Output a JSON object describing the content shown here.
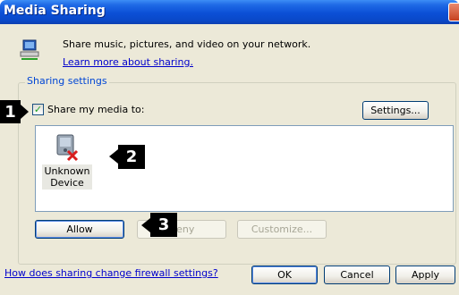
{
  "window": {
    "title": "Media Sharing"
  },
  "intro": {
    "text": "Share music, pictures, and video on your network.",
    "link": "Learn more about sharing."
  },
  "sharing_settings": {
    "group_label": "Sharing settings",
    "checkbox_label": "Share my media to:",
    "checkbox_checked": true,
    "settings_button": "Settings..."
  },
  "devices": [
    {
      "label": "Unknown Device",
      "icon": "media-device-icon"
    }
  ],
  "device_actions": {
    "allow": "Allow",
    "deny": "Deny",
    "customize": "Customize..."
  },
  "callouts": {
    "one": "1",
    "two": "2",
    "three": "3"
  },
  "footer": {
    "firewall_link": "How does sharing change firewall settings?",
    "ok": "OK",
    "cancel": "Cancel",
    "apply": "Apply"
  },
  "colors": {
    "title_bar": "#0b4fd6",
    "window_bg": "#ece9d8",
    "link": "#0000cc",
    "group_label": "#0046d5"
  }
}
